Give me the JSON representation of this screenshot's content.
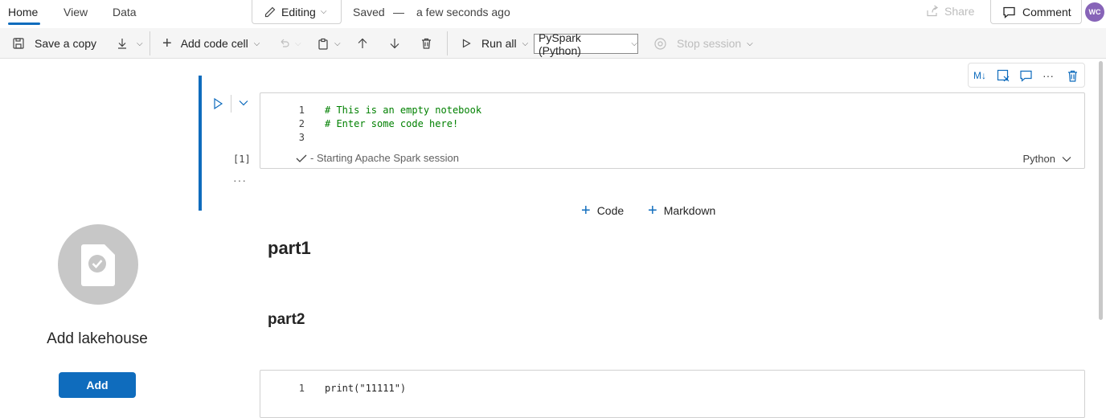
{
  "tabs": [
    "Home",
    "View",
    "Data"
  ],
  "mode_label": "Editing",
  "saved_label": "Saved",
  "saved_separator": "—",
  "saved_time": "a few seconds ago",
  "share_label": "Share",
  "comment_label": "Comment",
  "avatar_initials": "WC",
  "toolbar": {
    "save_copy": "Save a copy",
    "add_code_cell": "Add code cell",
    "run_all": "Run all",
    "language": "PySpark (Python)",
    "stop_session": "Stop session"
  },
  "left_panel": {
    "title": "Add lakehouse",
    "add_button": "Add"
  },
  "cell1": {
    "lines": [
      {
        "n": "1",
        "text": "# This is an empty notebook"
      },
      {
        "n": "2",
        "text": "# Enter some code here!"
      },
      {
        "n": "3",
        "text": ""
      }
    ],
    "status": "- Starting Apache Spark session",
    "language": "Python",
    "exec_count": "[1]"
  },
  "insert": {
    "code": "Code",
    "markdown": "Markdown"
  },
  "markdown": {
    "part1": "part1",
    "part2": "part2"
  },
  "cell2": {
    "lines": [
      {
        "n": "1",
        "text": "print(\"11111\")"
      }
    ]
  },
  "colors": {
    "accent": "#0f6cbd",
    "comment_green": "#008000",
    "avatar": "#8764b8"
  }
}
